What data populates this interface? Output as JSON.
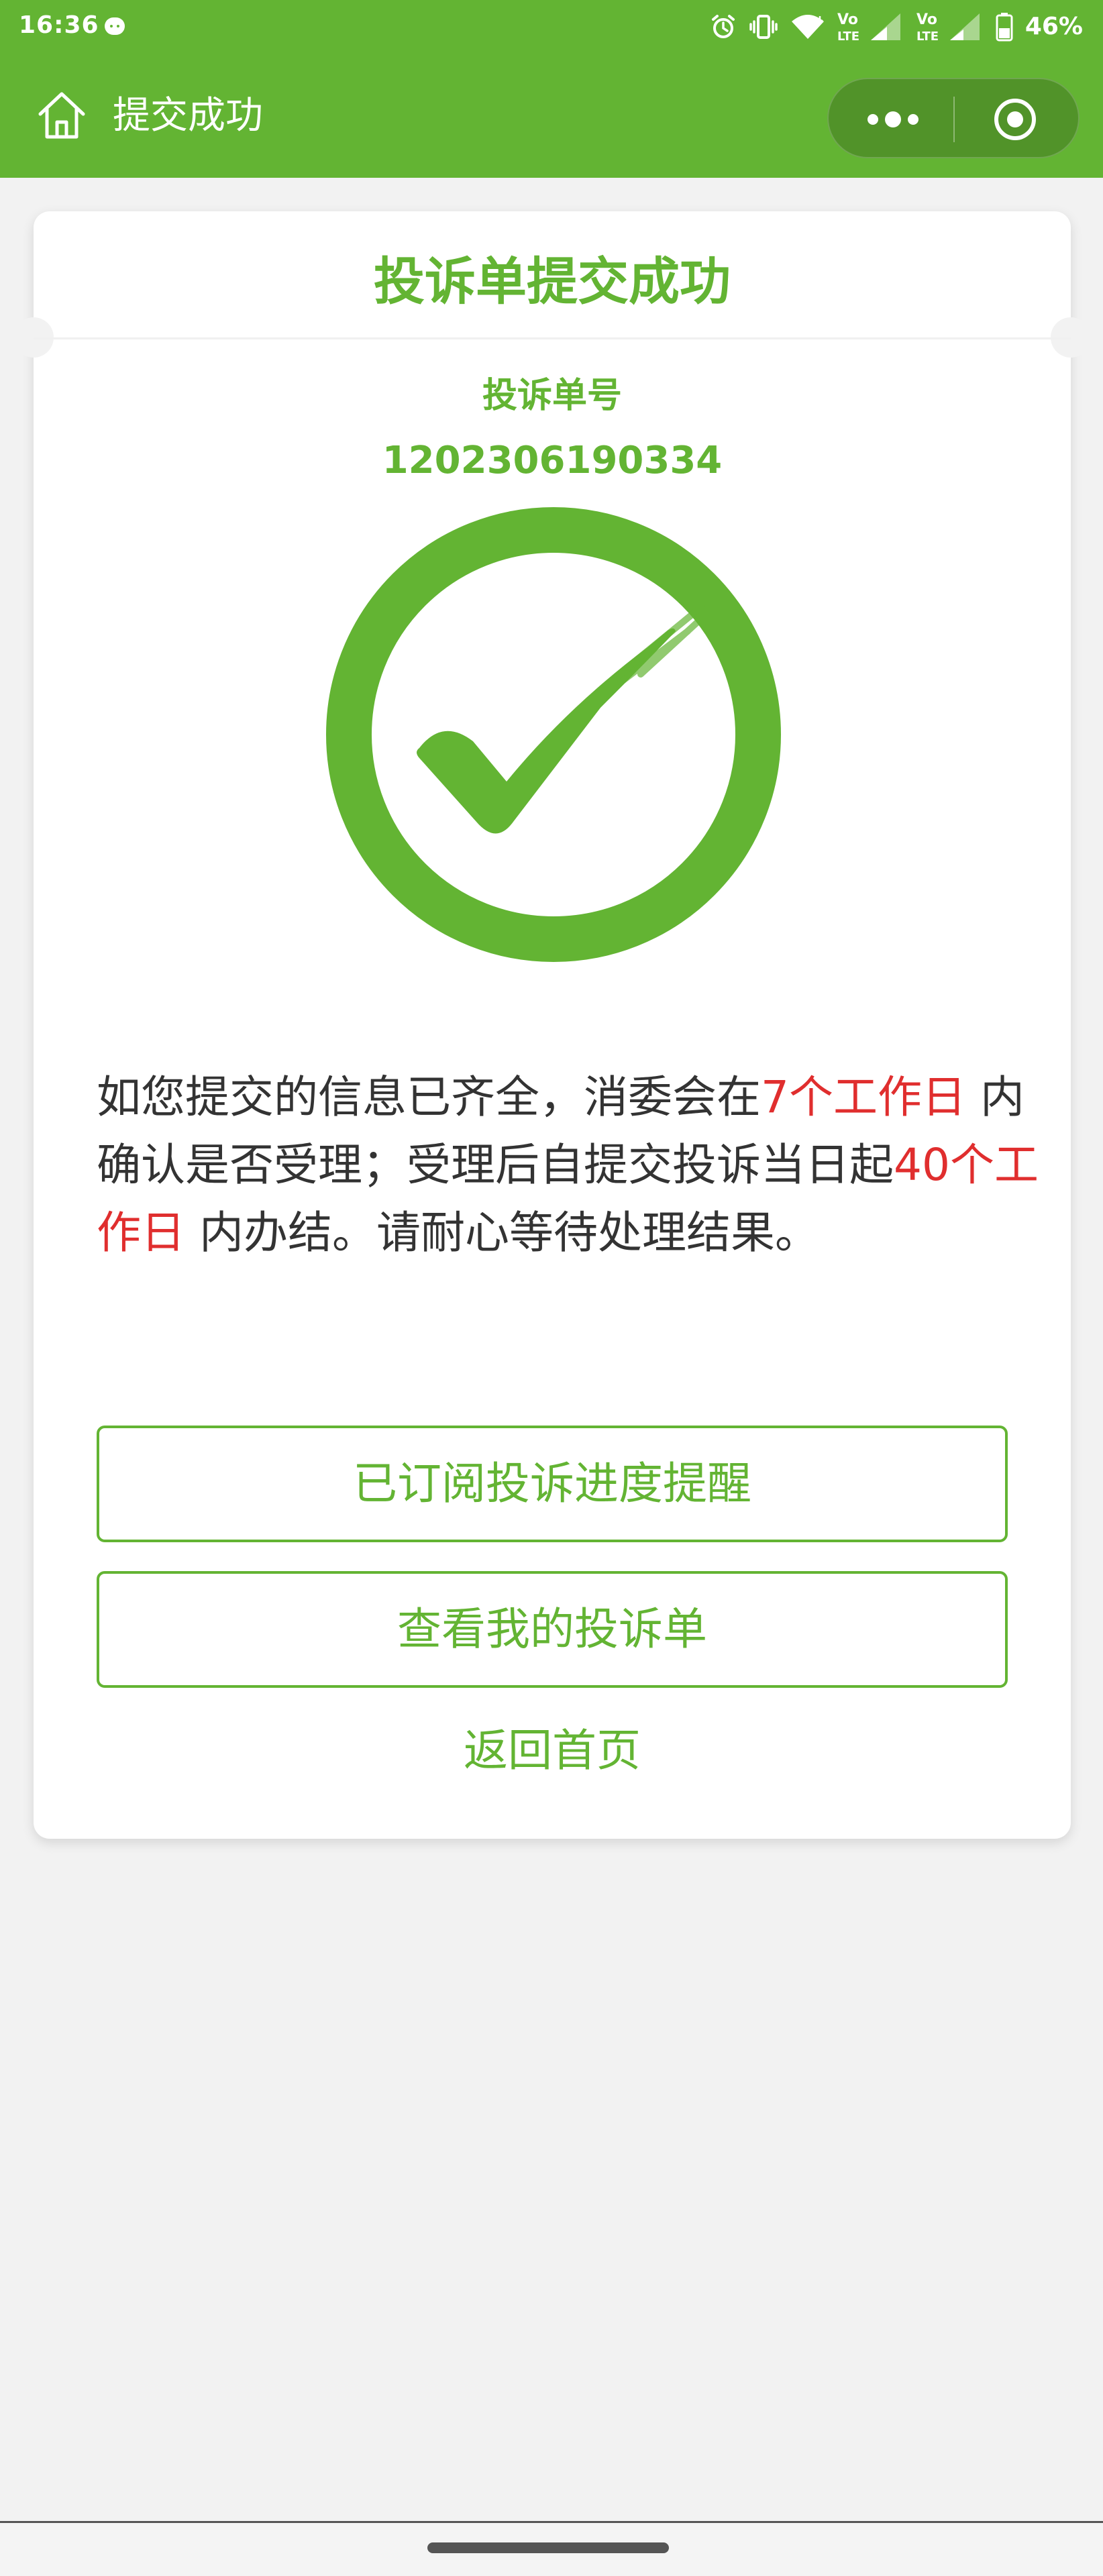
{
  "status_bar": {
    "time": "16:36",
    "battery": "46%",
    "icons": [
      "message-icon",
      "alarm-icon",
      "vibrate-icon",
      "wifi-icon",
      "volte-signal-icon",
      "volte-signal-icon",
      "battery-icon"
    ]
  },
  "header": {
    "title": "提交成功",
    "home_icon": "home-icon",
    "more_icon": "more-icon",
    "close_icon": "close-miniprogram-icon"
  },
  "card": {
    "title": "投诉单提交成功",
    "order_label": "投诉单号",
    "order_number": "1202306190334",
    "success_icon": "checkmark-circle-icon",
    "notice": {
      "part1": "如您提交的信息已齐全，消委会在",
      "highlight1": "7个工作日",
      "part2": " 内确认是否受理；受理后自提交投诉当日起",
      "highlight2": "40个工作日",
      "part3": " 内办结。请耐心等待处理结果。"
    },
    "buttons": {
      "subscribe": "已订阅投诉进度提醒",
      "view": "查看我的投诉单"
    },
    "back_link": "返回首页"
  },
  "colors": {
    "brand_green": "#63b433",
    "highlight_red": "#e02e2e",
    "text_dark": "#333333",
    "background": "#f2f2f2"
  }
}
